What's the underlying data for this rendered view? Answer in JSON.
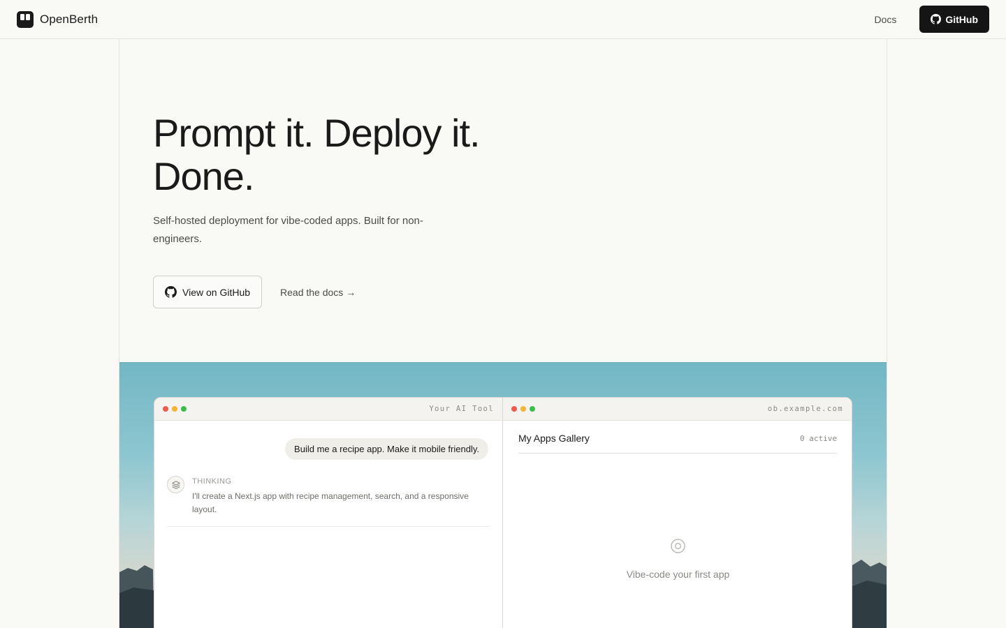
{
  "header": {
    "brand": "OpenBerth",
    "nav_docs": "Docs",
    "github_label": "GitHub"
  },
  "hero": {
    "title": "Prompt it. Deploy it. Done.",
    "subtitle": "Self-hosted deployment for vibe-coded apps. Built for non-engineers.",
    "cta_primary": "View on GitHub",
    "cta_secondary": "Read the docs →"
  },
  "left_window": {
    "label": "Your AI Tool",
    "user_message": "Build me a recipe app. Make it mobile friendly.",
    "thinking_label": "THINKING",
    "thinking_text": "I'll create a Next.js app with recipe management, search, and a responsive layout."
  },
  "right_window": {
    "label": "ob.example.com",
    "gallery_title": "My Apps Gallery",
    "gallery_count": "0 active",
    "empty_text": "Vibe-code your first app"
  },
  "icons": {
    "logo": "openberth-logo-icon",
    "github": "github-icon",
    "thinking": "layers-icon",
    "empty": "target-icon"
  },
  "colors": {
    "primary_button": "#151515",
    "background": "#f9f9f6",
    "sky_top": "#73b7c4",
    "dot_red": "#ef5a4f",
    "dot_yellow": "#f2b535",
    "dot_green": "#3cbd4b"
  }
}
